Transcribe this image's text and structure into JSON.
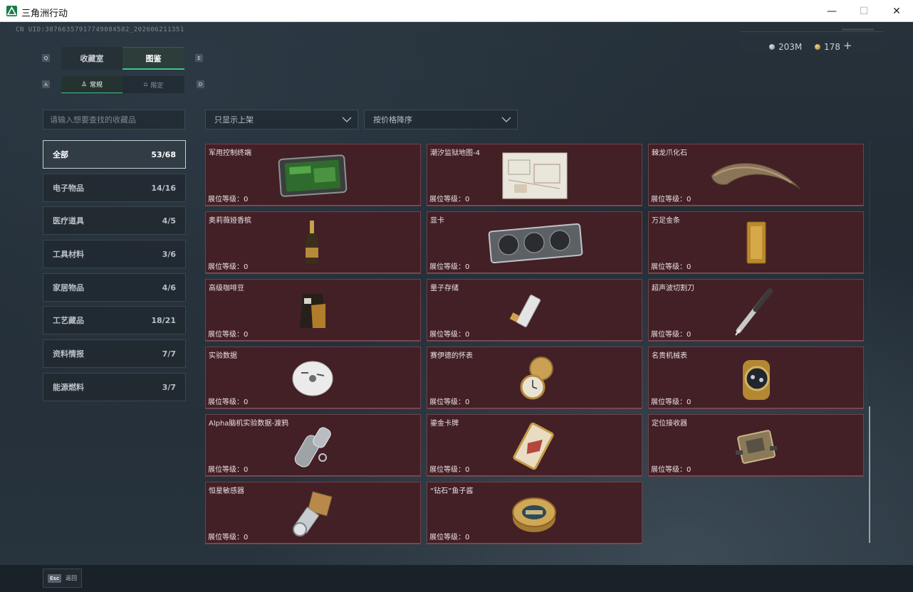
{
  "window": {
    "title": "三角洲行动",
    "minimize": "—",
    "maximize": "☐",
    "close": "✕"
  },
  "header": {
    "uid": "CN UID:3876635791774908​4582_202606211351",
    "currency1": "203M",
    "currency2": "178",
    "plus": "+"
  },
  "tabs": {
    "q": "Q",
    "e": "E",
    "a": "A",
    "d": "D",
    "collection": "收藏室",
    "catalog": "图鉴",
    "normal": "常规",
    "limited": "限定"
  },
  "search": {
    "placeholder": "请输入想要查找的收藏品"
  },
  "filters": {
    "shelf": "只显示上架",
    "sort": "按价格降序"
  },
  "categories": [
    {
      "label": "全部",
      "count": "53/68"
    },
    {
      "label": "电子物品",
      "count": "14/16"
    },
    {
      "label": "医疗道具",
      "count": "4/5"
    },
    {
      "label": "工具材料",
      "count": "3/6"
    },
    {
      "label": "家居物品",
      "count": "4/6"
    },
    {
      "label": "工艺藏品",
      "count": "18/21"
    },
    {
      "label": "资料情报",
      "count": "7/7"
    },
    {
      "label": "能源燃料",
      "count": "3/7"
    }
  ],
  "items": [
    {
      "name": "军用控制终端",
      "level": "展位等级：0",
      "icon": "control-terminal-icon"
    },
    {
      "name": "潮汐监狱地图-4",
      "level": "展位等级：0",
      "icon": "prison-map-icon"
    },
    {
      "name": "棘龙爪化石",
      "level": "展位等级：0",
      "icon": "claw-fossil-icon"
    },
    {
      "name": "奥莉薇娅香槟",
      "level": "展位等级：0",
      "icon": "champagne-icon"
    },
    {
      "name": "显卡",
      "level": "展位等级：0",
      "icon": "graphics-card-icon"
    },
    {
      "name": "万足金条",
      "level": "展位等级：0",
      "icon": "gold-bar-icon"
    },
    {
      "name": "高级咖啡豆",
      "level": "展位等级：0",
      "icon": "coffee-bag-icon"
    },
    {
      "name": "量子存储",
      "level": "展位等级：0",
      "icon": "quantum-storage-icon"
    },
    {
      "name": "超声波切割刀",
      "level": "展位等级：0",
      "icon": "ultrasonic-knife-icon"
    },
    {
      "name": "实验数据",
      "level": "展位等级：0",
      "icon": "disc-icon"
    },
    {
      "name": "赛伊德的怀表",
      "level": "展位等级：0",
      "icon": "pocket-watch-icon"
    },
    {
      "name": "名贵机械表",
      "level": "展位等级：0",
      "icon": "wristwatch-icon"
    },
    {
      "name": "Alpha脑机实验数据-渡鸦",
      "level": "展位等级：0",
      "icon": "data-capsule-icon"
    },
    {
      "name": "鎏金卡牌",
      "level": "展位等级：0",
      "icon": "gilded-card-icon"
    },
    {
      "name": "定位接收器",
      "level": "展位等级：0",
      "icon": "locator-receiver-icon"
    },
    {
      "name": "恒星敏感器",
      "level": "展位等级：0",
      "icon": "star-sensor-icon"
    },
    {
      "name": "“钻石”鱼子酱",
      "level": "展位等级：0",
      "icon": "caviar-tin-icon"
    }
  ],
  "footer": {
    "esc_key": "Esc",
    "esc_label": "返回"
  },
  "colors": {
    "card_bg": "#431f26",
    "card_border": "#704249",
    "accent": "#3fc48a"
  }
}
